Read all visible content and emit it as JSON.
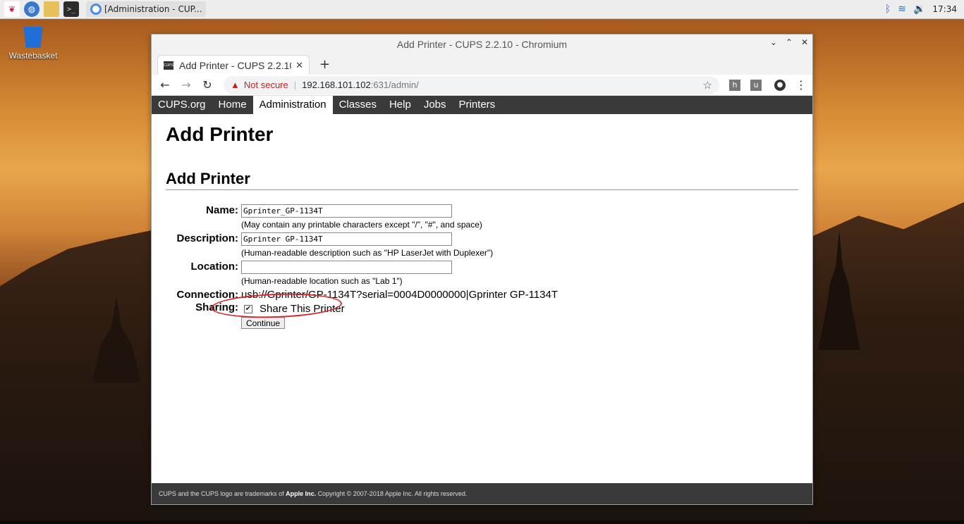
{
  "taskbar": {
    "window_title": "[Administration - CUP...",
    "clock": "17:34"
  },
  "desktop": {
    "trash_label": "Wastebasket"
  },
  "browser": {
    "window_title": "Add Printer - CUPS 2.2.10 - Chromium",
    "tab_title": "Add Printer - CUPS 2.2.10",
    "tab_favicon": "CUPS",
    "security_label": "Not secure",
    "url_host": "192.168.101.102",
    "url_path": ":631/admin/",
    "ext1": "h",
    "ext2": "u"
  },
  "cups": {
    "nav": [
      "CUPS.org",
      "Home",
      "Administration",
      "Classes",
      "Help",
      "Jobs",
      "Printers"
    ],
    "page_title": "Add Printer",
    "section_title": "Add Printer",
    "name_label": "Name:",
    "name_value": "Gprinter_GP-1134T",
    "name_hint": "(May contain any printable characters except \"/\", \"#\", and space)",
    "desc_label": "Description:",
    "desc_value": "Gprinter GP-1134T",
    "desc_hint": "(Human-readable description such as \"HP LaserJet with Duplexer\")",
    "loc_label": "Location:",
    "loc_value": "",
    "loc_hint": "(Human-readable location such as \"Lab 1\")",
    "conn_label": "Connection:",
    "conn_value": "usb://Gprinter/GP-1134T?serial=0004D0000000|Gprinter GP-1134T",
    "sharing_label": "Sharing:",
    "share_text": "Share This Printer",
    "continue_label": "Continue",
    "footer_pre": "CUPS and the CUPS logo are trademarks of",
    "footer_brand": "Apple Inc.",
    "footer_post": "Copyright © 2007-2018 Apple Inc. All rights reserved."
  },
  "colors": {
    "accent_red": "#d9262c",
    "nav_bg": "#3a3a3a"
  }
}
